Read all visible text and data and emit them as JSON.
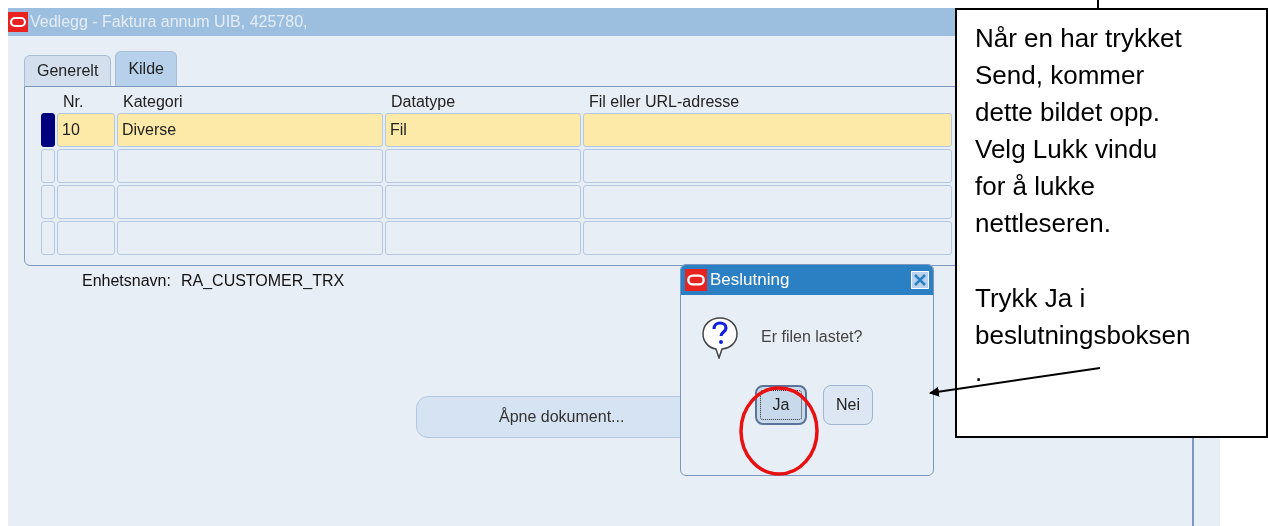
{
  "window": {
    "title": "Vedlegg - Faktura annum UIB, 425780,"
  },
  "tabs": [
    {
      "label": "Generelt",
      "selected": false
    },
    {
      "label": "Kilde",
      "selected": true
    }
  ],
  "table": {
    "columns": [
      "Nr.",
      "Kategori",
      "Datatype",
      "Fil eller URL-adresse"
    ],
    "rows": [
      {
        "cells": [
          "10",
          "Diverse",
          "Fil",
          ""
        ],
        "selected": true
      },
      {
        "cells": [
          "",
          "",
          "",
          ""
        ],
        "selected": false
      },
      {
        "cells": [
          "",
          "",
          "",
          ""
        ],
        "selected": false
      },
      {
        "cells": [
          "",
          "",
          "",
          ""
        ],
        "selected": false
      }
    ]
  },
  "entity": {
    "label": "Enhetsnavn:",
    "value": "RA_CUSTOMER_TRX"
  },
  "open_button": {
    "label": "Åpne dokument..."
  },
  "dialog": {
    "title": "Beslutning",
    "message": "Er filen lastet?",
    "buttons": [
      {
        "label": "Ja",
        "default": true
      },
      {
        "label": "Nei",
        "default": false
      }
    ]
  },
  "callout": {
    "paragraphs": [
      "Når en har trykket\nSend, kommer\ndette bildet opp.\nVelg Lukk vindu\nfor å lukke\nnettleseren.",
      "Trykk Ja i\nbeslutningsboksen"
    ],
    "trailing_mark": "."
  }
}
